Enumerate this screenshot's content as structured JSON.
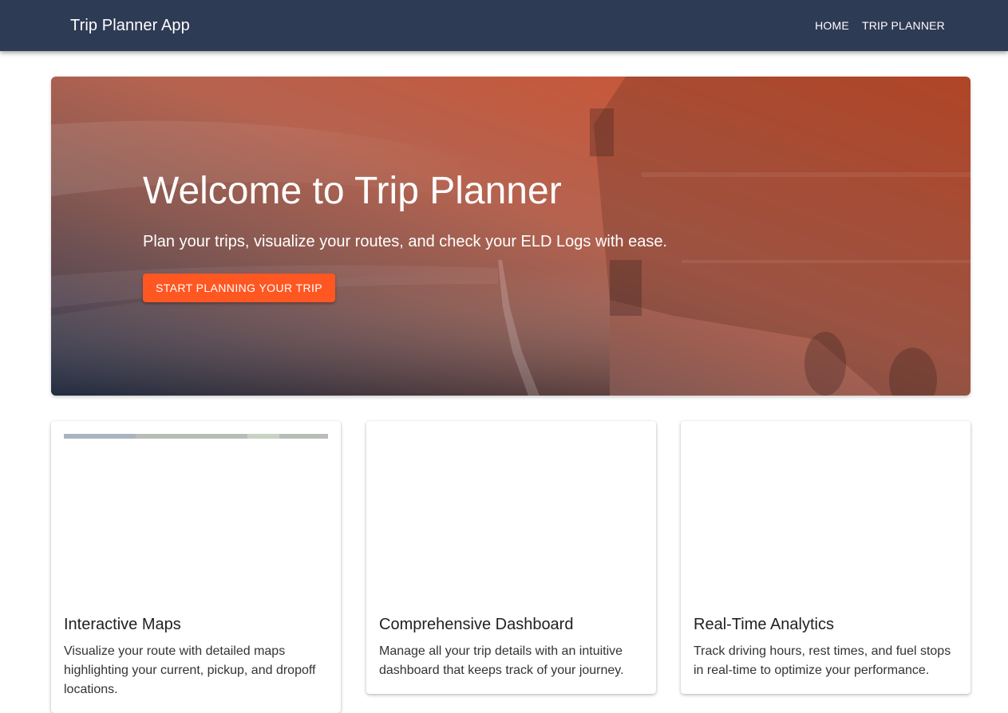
{
  "app": {
    "title": "Trip Planner App"
  },
  "nav": {
    "items": [
      {
        "label": "HOME"
      },
      {
        "label": "TRIP PLANNER"
      }
    ]
  },
  "hero": {
    "title": "Welcome to Trip Planner",
    "subtitle": "Plan your trips, visualize your routes, and check your ELD Logs with ease.",
    "cta_label": "START PLANNING YOUR TRIP",
    "overlay_colors": [
      "#2e3b55",
      "#a35e4e",
      "#d3502a"
    ],
    "cta_color": "#ff5722"
  },
  "features": [
    {
      "title": "Interactive Maps",
      "description": "Visualize your route with detailed maps highlighting your current, pickup, and dropoff locations."
    },
    {
      "title": "Comprehensive Dashboard",
      "description": "Manage all your trip details with an intuitive dashboard that keeps track of your journey."
    },
    {
      "title": "Real-Time Analytics",
      "description": "Track driving hours, rest times, and fuel stops in real-time to optimize your performance."
    }
  ],
  "colors": {
    "appbar": "#2e3b55",
    "accent": "#ff5722"
  }
}
